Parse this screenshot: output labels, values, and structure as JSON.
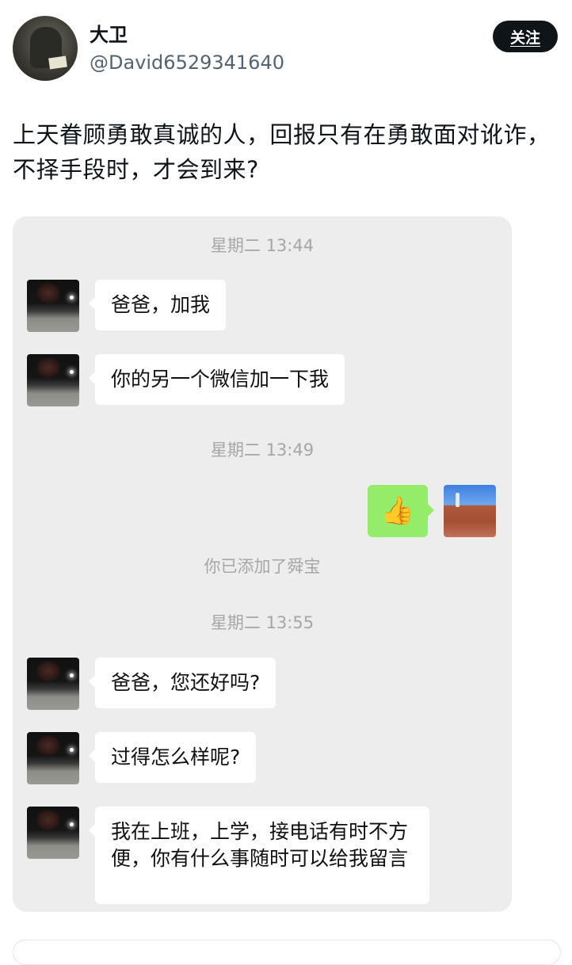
{
  "post": {
    "display_name": "大卫",
    "handle": "@David6529341640",
    "follow_label": "关注",
    "text": "上天眷顾勇敢真诚的人，回报只有在勇敢面对讹诈，不择手段时，才会到来?"
  },
  "chat": {
    "timestamps": [
      "星期二 13:44",
      "星期二 13:49",
      "星期二 13:55"
    ],
    "messages": [
      "爸爸，加我",
      "你的另一个微信加一下我",
      "爸爸，您还好吗?",
      "过得怎么样呢?",
      "我在上班，上学，接电话有时不方便，你有什么事随时可以给我留言"
    ],
    "sent_emoji": "👍",
    "system_note": "你已添加了舜宝"
  },
  "colors": {
    "follow_button_bg": "#0f1419",
    "chat_background": "#ededed",
    "sent_bubble": "#95ec69",
    "received_bubble": "#ffffff",
    "meta_text": "#a6a6a6"
  },
  "icons": {
    "thumbs_up": "thumbs-up-emoji"
  }
}
